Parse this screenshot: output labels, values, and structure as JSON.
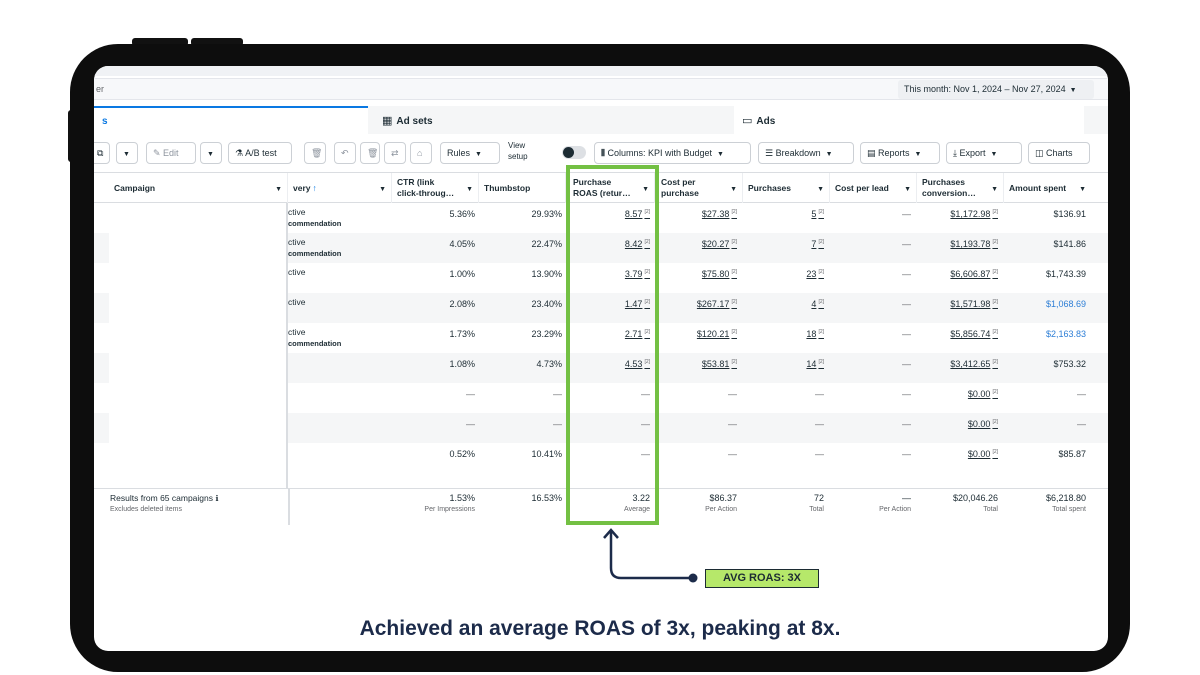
{
  "filter": {
    "text": "er"
  },
  "date_range": "This month: Nov 1, 2024 – Nov 27, 2024",
  "tabs": [
    {
      "label": "s",
      "icon": "folder-icon"
    },
    {
      "label": "Ad sets",
      "icon": "grid-icon"
    },
    {
      "label": "Ads",
      "icon": "ad-icon"
    }
  ],
  "toolbar": {
    "edit": "Edit",
    "ab_test": "A/B test",
    "rules": "Rules",
    "view_setup": [
      "View",
      "setup"
    ],
    "columns": "Columns: KPI with Budget",
    "breakdown": "Breakdown",
    "reports": "Reports",
    "export": "Export",
    "charts": "Charts"
  },
  "columns": {
    "campaign": "Campaign",
    "delivery": "very",
    "ctr": [
      "CTR (link",
      "click-throug…"
    ],
    "thumbstop": "Thumbstop",
    "roas": [
      "Purchase",
      "ROAS (retur…"
    ],
    "cost_per_purchase": [
      "Cost per",
      "purchase"
    ],
    "purchases": "Purchases",
    "cost_per_lead": "Cost per lead",
    "conversion": [
      "Purchases",
      "conversion…"
    ],
    "amount_spent": "Amount spent"
  },
  "rows": [
    {
      "delivery": "ctive",
      "rec": "commendation",
      "ctr": "5.36%",
      "thumbstop": "29.93%",
      "roas": "8.57",
      "cpp": "$27.38",
      "purchases": "5",
      "cpl": "—",
      "conv": "$1,172.98",
      "spent": "$136.91",
      "spent_blue": false
    },
    {
      "delivery": "ctive",
      "rec": "commendation",
      "ctr": "4.05%",
      "thumbstop": "22.47%",
      "roas": "8.42",
      "cpp": "$20.27",
      "purchases": "7",
      "cpl": "—",
      "conv": "$1,193.78",
      "spent": "$141.86",
      "spent_blue": false
    },
    {
      "delivery": "ctive",
      "rec": "",
      "ctr": "1.00%",
      "thumbstop": "13.90%",
      "roas": "3.79",
      "cpp": "$75.80",
      "purchases": "23",
      "cpl": "—",
      "conv": "$6,606.87",
      "spent": "$1,743.39",
      "spent_blue": false
    },
    {
      "delivery": "ctive",
      "rec": "",
      "ctr": "2.08%",
      "thumbstop": "23.40%",
      "roas": "1.47",
      "cpp": "$267.17",
      "purchases": "4",
      "cpl": "—",
      "conv": "$1,571.98",
      "spent": "$1,068.69",
      "spent_blue": true
    },
    {
      "delivery": "ctive",
      "rec": "commendation",
      "ctr": "1.73%",
      "thumbstop": "23.29%",
      "roas": "2.71",
      "cpp": "$120.21",
      "purchases": "18",
      "cpl": "—",
      "conv": "$5,856.74",
      "spent": "$2,163.83",
      "spent_blue": true
    },
    {
      "delivery": "",
      "rec": "",
      "ctr": "1.08%",
      "thumbstop": "4.73%",
      "roas": "4.53",
      "cpp": "$53.81",
      "purchases": "14",
      "cpl": "—",
      "conv": "$3,412.65",
      "spent": "$753.32",
      "spent_blue": false
    },
    {
      "delivery": "",
      "rec": "",
      "ctr": "—",
      "thumbstop": "—",
      "roas": "—",
      "cpp": "—",
      "purchases": "—",
      "cpl": "—",
      "conv": "$0.00",
      "spent": "—",
      "spent_blue": false
    },
    {
      "delivery": "",
      "rec": "",
      "ctr": "—",
      "thumbstop": "—",
      "roas": "—",
      "cpp": "—",
      "purchases": "—",
      "cpl": "—",
      "conv": "$0.00",
      "spent": "—",
      "spent_blue": false
    },
    {
      "delivery": "",
      "rec": "",
      "ctr": "0.52%",
      "thumbstop": "10.41%",
      "roas": "—",
      "cpp": "—",
      "purchases": "—",
      "cpl": "—",
      "conv": "$0.00",
      "spent": "$85.87",
      "spent_blue": false
    }
  ],
  "totals": {
    "results": "Results from 65 campaigns",
    "excludes": "Excludes deleted items",
    "ctr": "1.53%",
    "ctr_sub": "Per Impressions",
    "thumbstop": "16.53%",
    "roas": "3.22",
    "roas_sub": "Average",
    "cpp": "$86.37",
    "cpp_sub": "Per Action",
    "purchases": "72",
    "purchases_sub": "Total",
    "cpl": "—",
    "cpl_sub": "Per Action",
    "conv": "$20,046.26",
    "conv_sub": "Total",
    "spent": "$6,218.80",
    "spent_sub": "Total spent"
  },
  "annotation": {
    "badge": "AVG ROAS: 3X",
    "caption": "Achieved an average ROAS of 3x, peaking at 8x.",
    "highlight_color": "#73c043",
    "badge_color": "#b6e86a"
  }
}
